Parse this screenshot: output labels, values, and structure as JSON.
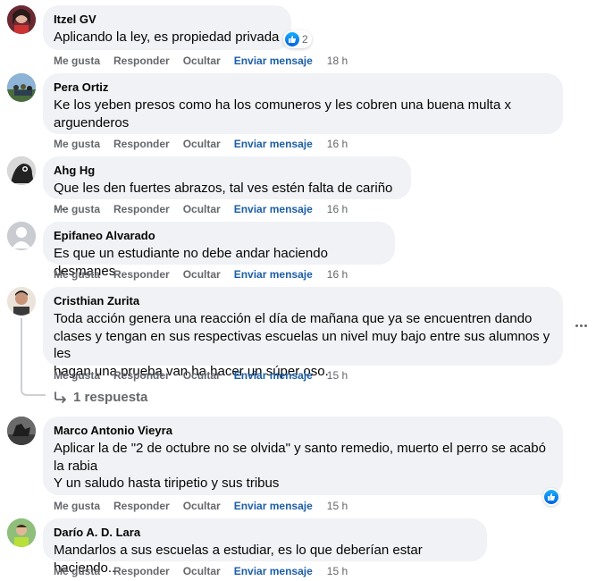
{
  "action_labels": {
    "like": "Me gusta",
    "reply": "Responder",
    "hide": "Ocultar",
    "send": "Enviar mensaje"
  },
  "comments": [
    {
      "author": "Itzel GV",
      "text": "Aplicando la ley, es propiedad privada",
      "time": "18 h",
      "reactions": {
        "icon": "like-icon",
        "count": "2"
      }
    },
    {
      "author": "Pera Ortiz",
      "text": "Ke los yeben presos como ha los comuneros y les cobren una buena multa x\narguenderos",
      "time": "16 h"
    },
    {
      "author": "Ahg Hg",
      "text": "Que les den fuertes abrazos, tal ves estén falta de cariño ....",
      "time": "16 h"
    },
    {
      "author": "Epifaneo Alvarado",
      "text": "Es que un estudiante no debe andar haciendo desmanes",
      "time": "16 h"
    },
    {
      "author": "Cristhian Zurita",
      "text": "Toda acción genera una reacción el día de mañana que ya se encuentren dando\nclases y tengan en sus respectivas escuelas un nivel muy bajo entre sus alumnos y les\nhagan una prueba van ha hacer un súper oso.",
      "time": "15 h",
      "replies_label": "1 respuesta"
    },
    {
      "author": "Marco Antonio Vieyra",
      "text": "Aplicar la de \"2 de octubre no se olvida\" y santo remedio, muerto el perro se acabó\nla rabia\nY un saludo hasta tiripetio y sus tribus",
      "time": "15 h",
      "reactions": {
        "icon": "like-icon",
        "count": ""
      }
    },
    {
      "author": "Darío A. D. Lara",
      "text": "Mandarlos a sus escuelas a estudiar, es lo que deberían estar haciendo...",
      "time": "15 h"
    }
  ],
  "colors": {
    "bubble": "#f0f2f5",
    "link": "#1c5ea8",
    "muted": "#65676b",
    "like_blue": "#0866ff"
  }
}
